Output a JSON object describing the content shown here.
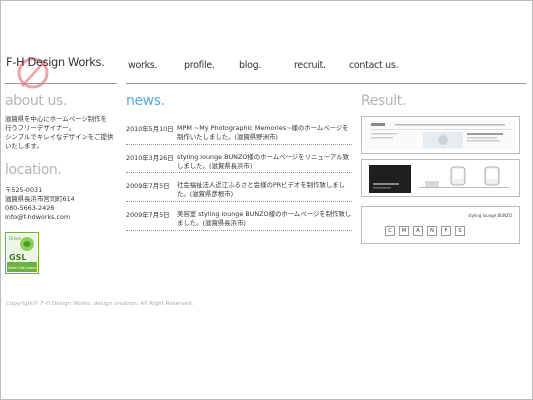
{
  "site": {
    "logo_text": "F-H Design Works."
  },
  "nav": [
    {
      "label": "works."
    },
    {
      "label": "profile."
    },
    {
      "label": "blog."
    },
    {
      "label": "recruit."
    },
    {
      "label": "contact us."
    }
  ],
  "about": {
    "heading": "about us.",
    "lines": [
      "滋賀県を中心にホームページ制作を",
      "行うフリーデザイナー。",
      "シンプルでキレイなデザインをご提供",
      "いたします。"
    ]
  },
  "location": {
    "heading": "location.",
    "lines": [
      "〒525-0031",
      "滋賀県長浜市宮司町614",
      "080-5663-2426",
      "info@f-hdworks.com"
    ]
  },
  "badge": {
    "top": "Green",
    "main": "GSL",
    "bottom": "Green Site License"
  },
  "news": {
    "heading": "news.",
    "items": [
      {
        "date": "2010年5月10日",
        "text": "MPM ~My Photographic Memories~様のホームページを制作いたしました。(滋賀県野洲市)"
      },
      {
        "date": "2010年3月26日",
        "text": "styling lounge BUNZO様のホームページをリニューアル致しました。(滋賀県長浜市)"
      },
      {
        "date": "2009年7月5日",
        "text": "社会福祉法人近江ふるさと会様のPRビデオを制作致しました。(滋賀県彦根市)"
      },
      {
        "date": "2009年7月5日",
        "text": "美容室 styling lounge BUNZO様のホームページを制作致しました。(滋賀県長浜市)"
      }
    ]
  },
  "result": {
    "heading": "Result.",
    "thumbs": [
      {
        "caption": ""
      },
      {
        "caption": ""
      },
      {
        "caption": "styling lounge BUNZO",
        "letters": [
          "C",
          "M",
          "A",
          "N",
          "F",
          "S"
        ]
      }
    ]
  },
  "footer": {
    "text": "Copyright© F-H Design Works. design creation. All Right Reserved."
  },
  "colors": {
    "news_heading": "#5aa9e6",
    "heading_gray": "#b5b5b5",
    "logo_accent": "#e8858c",
    "badge_green": "#6cb33e"
  }
}
